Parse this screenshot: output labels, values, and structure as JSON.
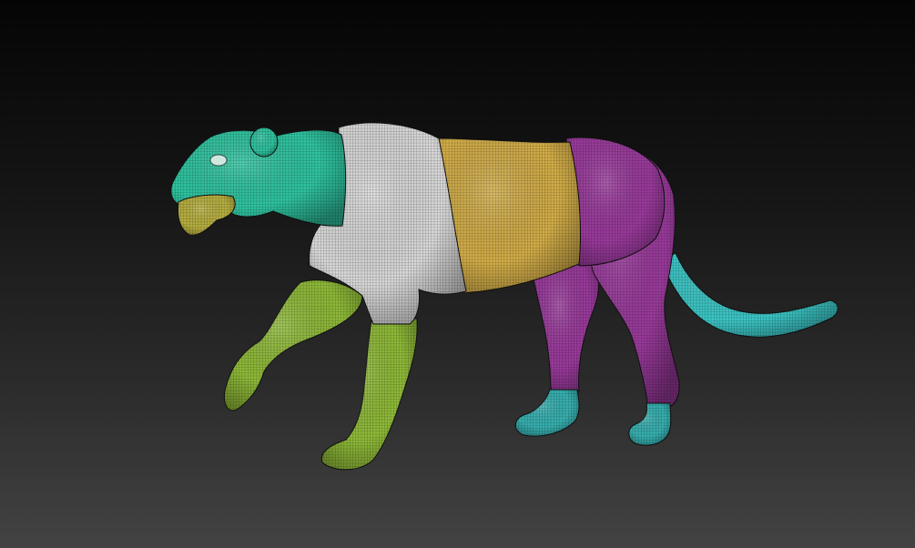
{
  "viewport": {
    "background_top": "#050505",
    "background_bottom": "#434343"
  },
  "model": {
    "subject": "lioness-sculpt-wireframe",
    "polygroups": {
      "head": "#2fc4a0",
      "muzzle": "#b8b040",
      "shoulders": "#d8d8d8",
      "torso": "#d2ad48",
      "hindquarters": "#9a3a9c",
      "front-legs": "#8fba38",
      "tail": "#3cc6c6",
      "hind-paws": "#37b0b0"
    }
  }
}
